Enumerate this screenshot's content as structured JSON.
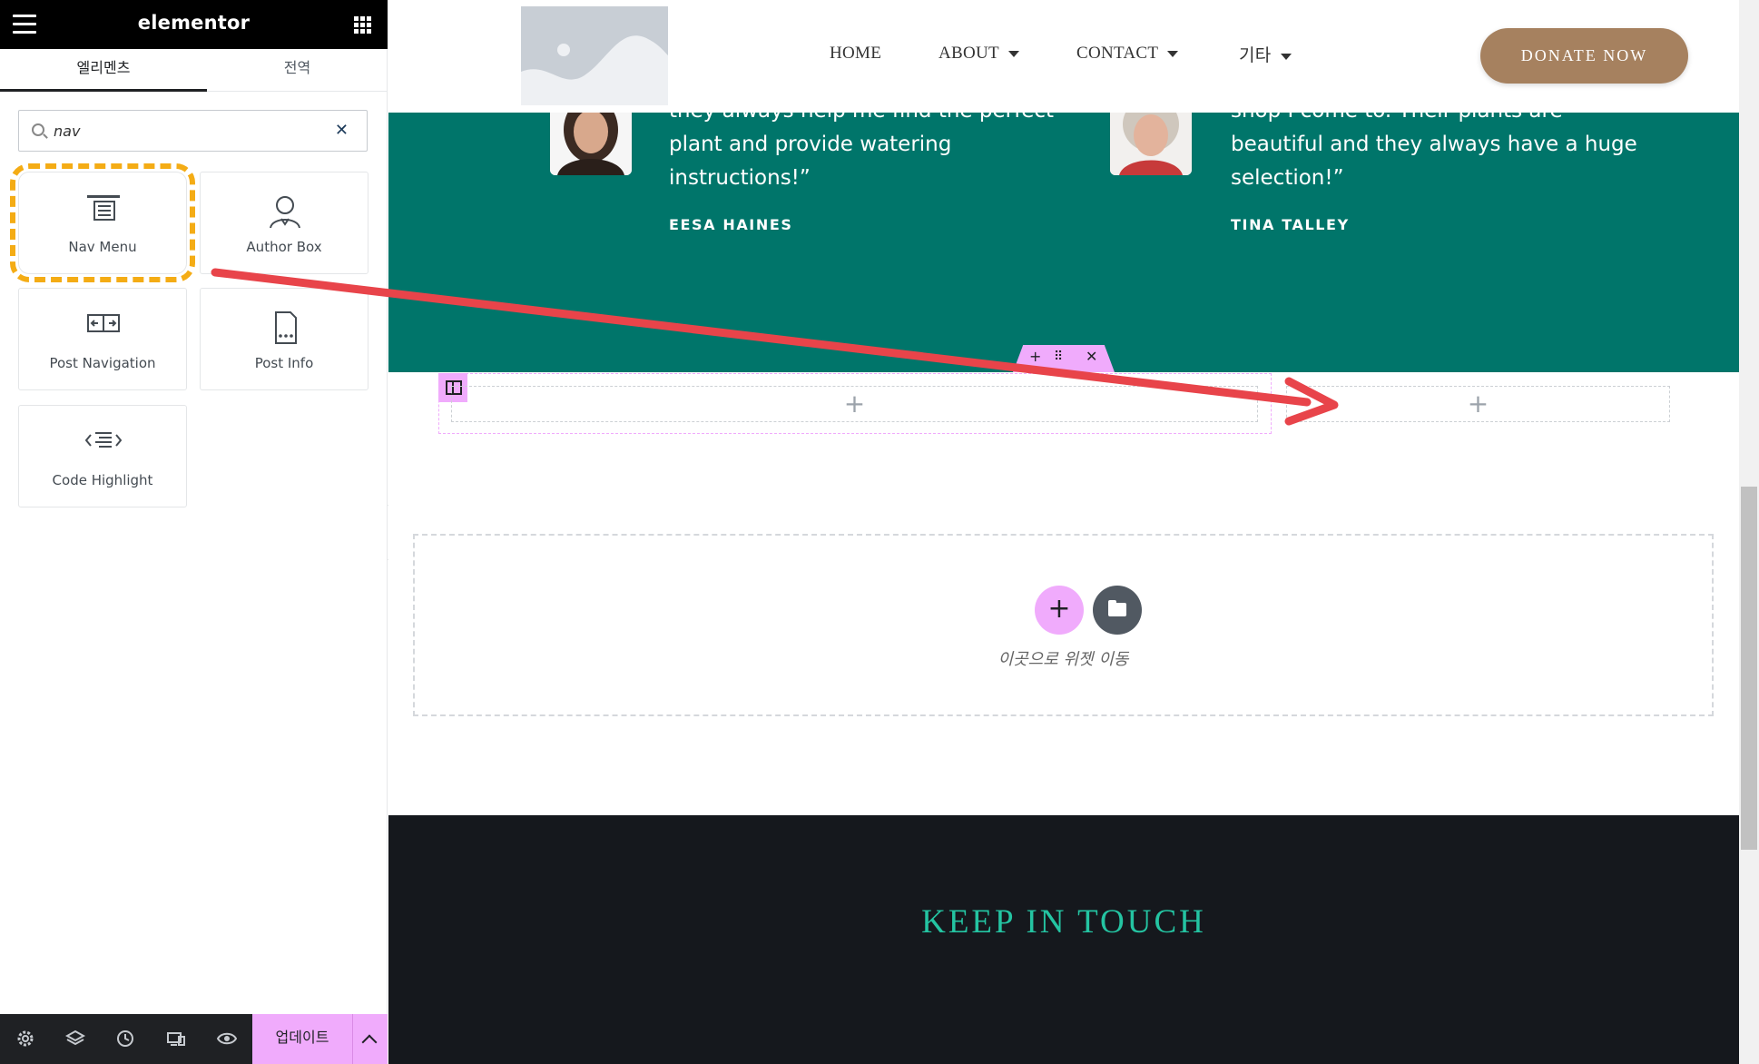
{
  "editor": {
    "logo": "elementor",
    "tabs": [
      "엘리멘츠",
      "전역"
    ],
    "search": {
      "value": "nav"
    },
    "widgets": [
      {
        "label": "Nav Menu",
        "icon": "nav-menu-icon"
      },
      {
        "label": "Author Box",
        "icon": "author-box-icon"
      },
      {
        "label": "Post Navigation",
        "icon": "post-navigation-icon"
      },
      {
        "label": "Post Info",
        "icon": "post-info-icon"
      },
      {
        "label": "Code Highlight",
        "icon": "code-highlight-icon"
      }
    ],
    "footer": {
      "update_label": "업데이트"
    }
  },
  "site": {
    "nav": [
      "HOME",
      "ABOUT",
      "CONTACT",
      "기타"
    ],
    "donate_label": "DONATE NOW",
    "testimonials": [
      {
        "quote": "they always help me find the perfect plant and provide watering instructions!”",
        "author": "EESA HAINES"
      },
      {
        "quote": "shop I come to. Their plants are beautiful and they always have a huge selection!”",
        "author": "TINA TALLEY"
      }
    ],
    "dropzone_text": "이곳으로 위젯 이동",
    "footer_title": "KEEP IN TOUCH"
  },
  "colors": {
    "teal": "#00756a",
    "accent_pink": "#f0abfc",
    "donate": "#a6815f",
    "highlight": "#f4ac15",
    "footer_title": "#24c4a2",
    "arrow": "#e8444a"
  }
}
